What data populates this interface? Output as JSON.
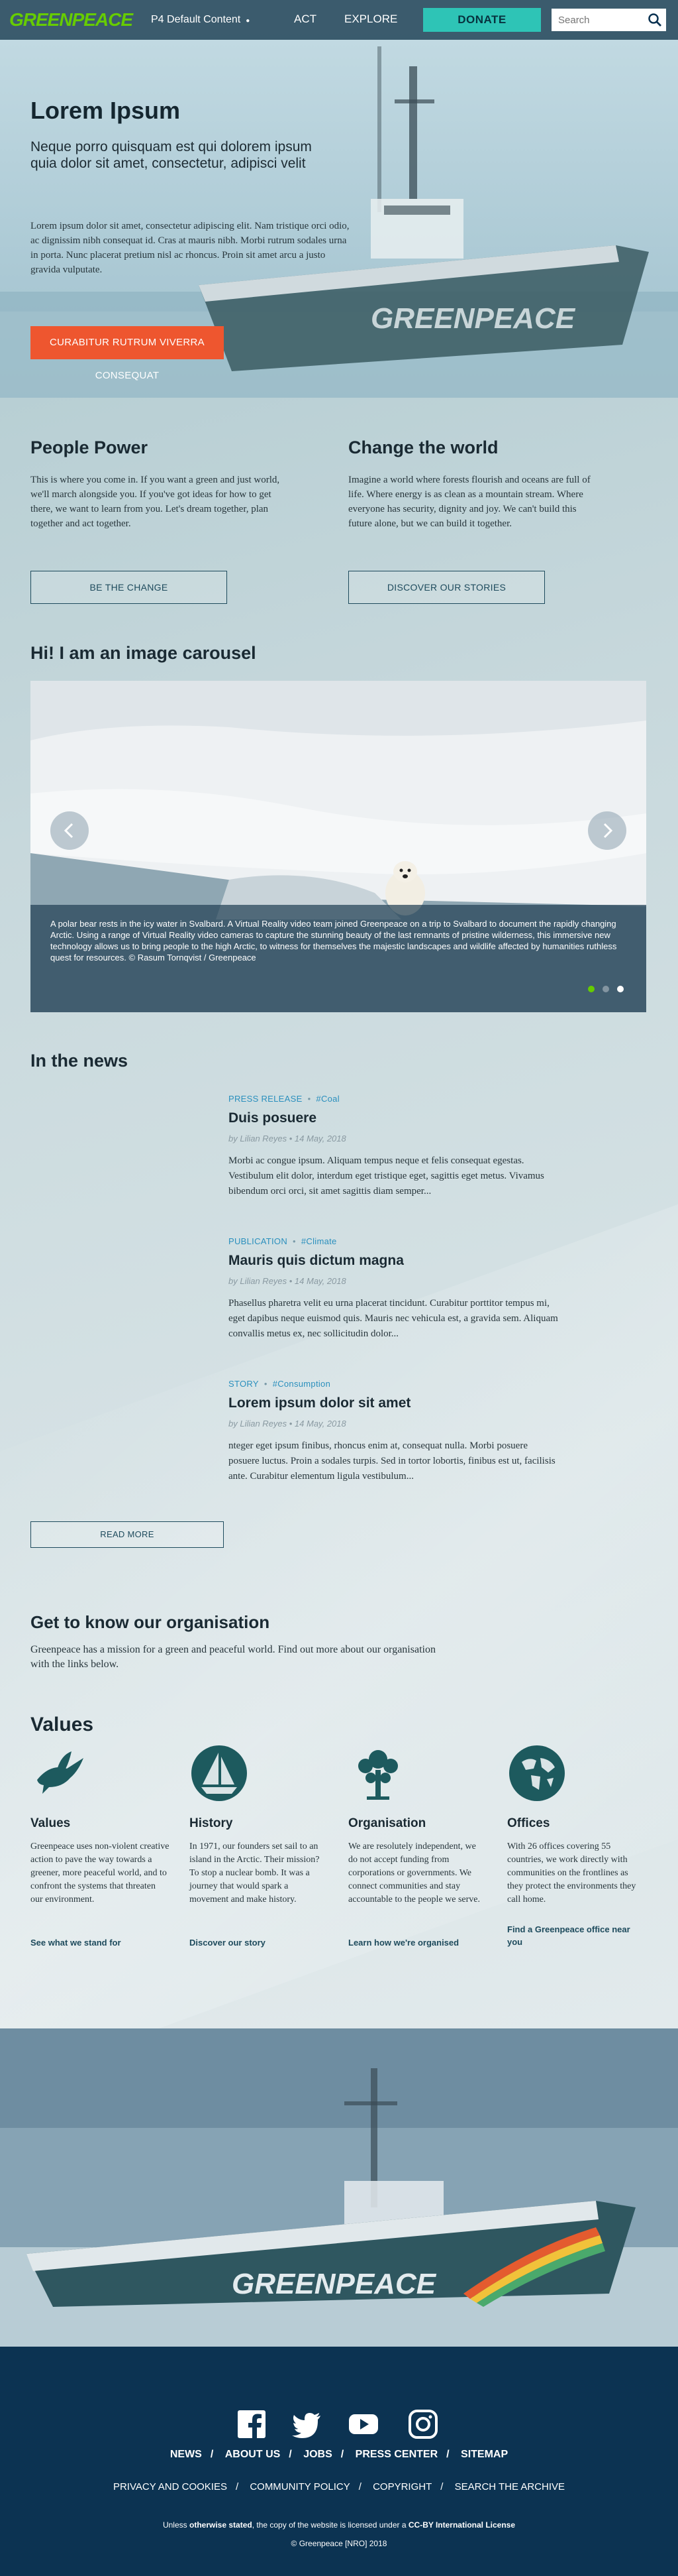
{
  "nav": {
    "logo": "GREENPEACE",
    "site_selector": "P4 Default Content",
    "act": "ACT",
    "explore": "EXPLORE",
    "donate": "DONATE",
    "search_placeholder": "Search"
  },
  "hero": {
    "title": "Lorem Ipsum",
    "subtitle": "Neque porro quisquam est qui dolorem ipsum quia dolor sit amet, consectetur, adipisci velit",
    "body": "Lorem ipsum dolor sit amet, consectetur adipiscing elit. Nam tristique orci odio, ac dignissim nibh consequat id. Cras at mauris nibh. Morbi rutrum sodales urna in porta. Nunc placerat pretium nisl ac rhoncus. Proin sit amet arcu a justo gravida vulputate.",
    "cta": "CURABITUR RUTRUM VIVERRA CONSEQUAT"
  },
  "tasks": [
    {
      "title": "People Power",
      "body": "This is where you come in. If you want a green and just world, we'll march alongside you. If you've got ideas for how to get there, we want to learn from you. Let's dream together, plan together and act together.",
      "button": "BE THE CHANGE"
    },
    {
      "title": "Change the world",
      "body": "Imagine a world where forests flourish and oceans are full of life. Where energy is as clean as a mountain stream. Where everyone has security, dignity and joy. We can't build this future alone, but we can build it together.",
      "button": "DISCOVER OUR STORIES"
    }
  ],
  "carousel": {
    "title": "Hi! I am an image carousel",
    "caption": "A polar bear rests in the icy water in Svalbard. A Virtual Reality video team joined Greenpeace on a trip to Svalbard to document the rapidly changing Arctic. Using a range of Virtual Reality video cameras to capture the stunning beauty of the last remnants of pristine wilderness, this immersive new technology allows us to bring people to the high Arctic, to witness for themselves the majestic landscapes and wildlife affected by humanities ruthless quest for resources. © Rasum Tornqvist / Greenpeace",
    "active_slide": 1,
    "slide_count": 3,
    "colors": {
      "active_dot": "#66cc00",
      "inactive_dot": "#ffffff"
    }
  },
  "news": {
    "title": "In the news",
    "items": [
      {
        "type": "PRESS RELEASE",
        "tag": "#Coal",
        "title": "Duis posuere",
        "meta": "by Lilian Reyes • 14 May, 2018",
        "body": "Morbi ac congue ipsum. Aliquam tempus neque et felis consequat egestas. Vestibulum elit dolor, interdum eget tristique eget, sagittis eget metus. Vivamus bibendum orci orci, sit amet sagittis diam semper..."
      },
      {
        "type": "PUBLICATION",
        "tag": "#Climate",
        "title": "Mauris quis dictum magna",
        "meta": "by Lilian Reyes • 14 May, 2018",
        "body": "Phasellus pharetra velit eu urna placerat tincidunt. Curabitur porttitor tempus mi, eget dapibus neque euismod quis. Mauris nec vehicula est, a gravida sem. Aliquam convallis metus ex, nec sollicitudin dolor..."
      },
      {
        "type": "STORY",
        "tag": "#Consumption",
        "title": "Lorem ipsum dolor sit amet",
        "meta": "by Lilian Reyes • 14 May, 2018",
        "body": "nteger eget ipsum finibus, rhoncus enim at, consequat nulla. Morbi posuere posuere luctus. Proin a sodales turpis. Sed in tortor lobortis, finibus est ut, facilisis ante. Curabitur elementum ligula vestibulum..."
      }
    ],
    "read_more": "READ MORE"
  },
  "organisation": {
    "title": "Get to know our organisation",
    "body": "Greenpeace has a mission for a green and peaceful world. Find out more about our organisation with the links below."
  },
  "values": {
    "title": "Values",
    "items": [
      {
        "icon": "dove-icon",
        "title": "Values",
        "body": "Greenpeace uses non-violent creative action to pave the way towards a greener, more peaceful world, and to confront the systems that threaten our environment.",
        "link": "See what we stand for"
      },
      {
        "icon": "sailboat-icon",
        "title": "History",
        "body": "In 1971, our founders set sail to an island in the Arctic. Their mission? To stop a nuclear bomb. It was a journey that would spark a movement and make history.",
        "link": "Discover our story"
      },
      {
        "icon": "tree-icon",
        "title": "Organisation",
        "body": "We are resolutely independent, we do not accept funding from corporations or governments. We connect communities and stay accountable to the people we serve.",
        "link": "Learn how we're organised"
      },
      {
        "icon": "globe-icon",
        "title": "Offices",
        "body": "With 26 offices covering 55 countries, we work directly with communities on the frontlines as they protect the environments they call home.",
        "link": "Find a Greenpeace office near you"
      }
    ]
  },
  "footer": {
    "social": [
      "facebook-icon",
      "twitter-icon",
      "youtube-icon",
      "instagram-icon"
    ],
    "primary_links": [
      "NEWS",
      "ABOUT US",
      "JOBS",
      "PRESS CENTER",
      "SITEMAP"
    ],
    "secondary_links": [
      "PRIVACY AND COOKIES",
      "COMMUNITY POLICY",
      "COPYRIGHT",
      "SEARCH THE ARCHIVE"
    ],
    "license_prefix": "Unless",
    "license_emph": "otherwise stated",
    "license_mid": ", the copy of the website is licensed under a",
    "license_link": "CC-BY International License",
    "copyright": "© Greenpeace [NRO] 2018"
  },
  "colors": {
    "brand_green": "#66cc00",
    "donate": "#2ec4b6",
    "cta_orange": "#ee562f",
    "link_blue": "#2a8fbd",
    "footer_bg": "#0c3352",
    "icon_teal": "#1d5a5e"
  }
}
